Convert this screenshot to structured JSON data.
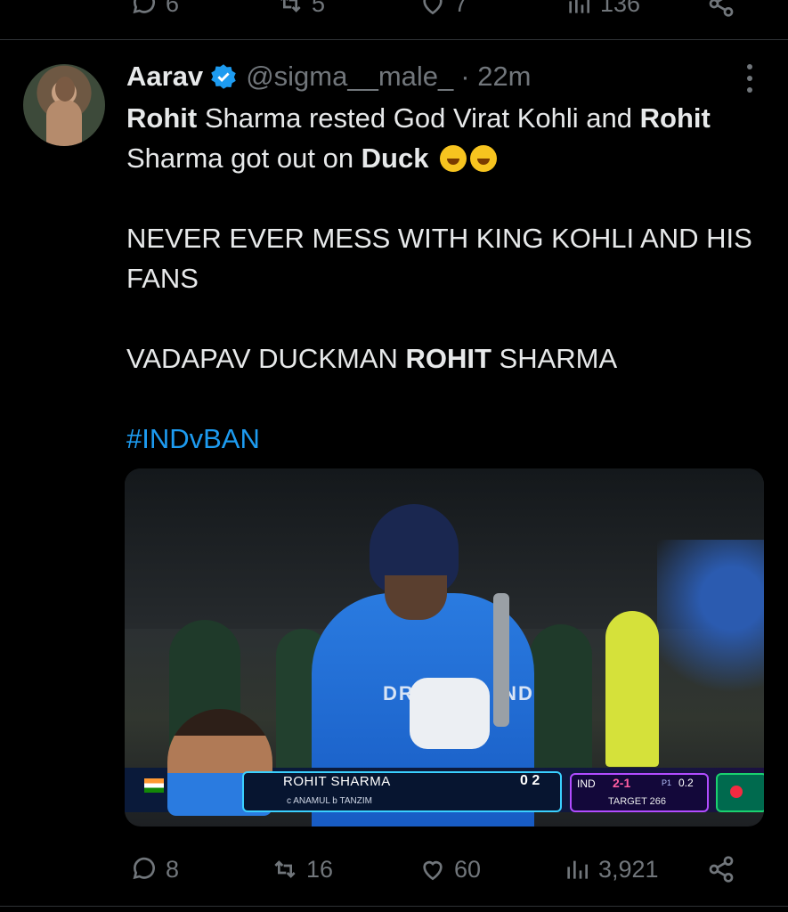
{
  "previous_tweet": {
    "reply_count": "6",
    "retweet_count": "5",
    "like_count": "7",
    "view_count": "136"
  },
  "tweet": {
    "name": "Aarav",
    "handle": "@sigma__male_",
    "time": "· 22m",
    "lines": {
      "l1a": "Rohit",
      "l1b": " Sharma rested God Virat Kohli and ",
      "l1c": "Rohit",
      "l2a": "Sharma got out on ",
      "l2b": "Duck",
      "p2": "NEVER EVER MESS WITH KING KOHLI AND HIS FANS",
      "p3a": "VADAPAV DUCKMAN ",
      "p3b": "ROHIT",
      "p3c": " SHARMA",
      "hashtag": "#INDvBAN"
    },
    "media": {
      "jersey_text": "DREAM11 IND",
      "scoreboard": {
        "batsman": "ROHIT SHARMA",
        "dismissal": "c ANAMUL b TANZIM",
        "runs": "0 2",
        "team": "IND",
        "score": "2-1",
        "innings": "P1",
        "overs": "0.2",
        "target": "TARGET 266"
      }
    },
    "stats": {
      "replies": "8",
      "retweets": "16",
      "likes": "60",
      "views": "3,921"
    }
  },
  "colors": {
    "background": "#000000",
    "text": "#e7e9ea",
    "muted": "#71767b",
    "accent": "#1d9bf0"
  }
}
